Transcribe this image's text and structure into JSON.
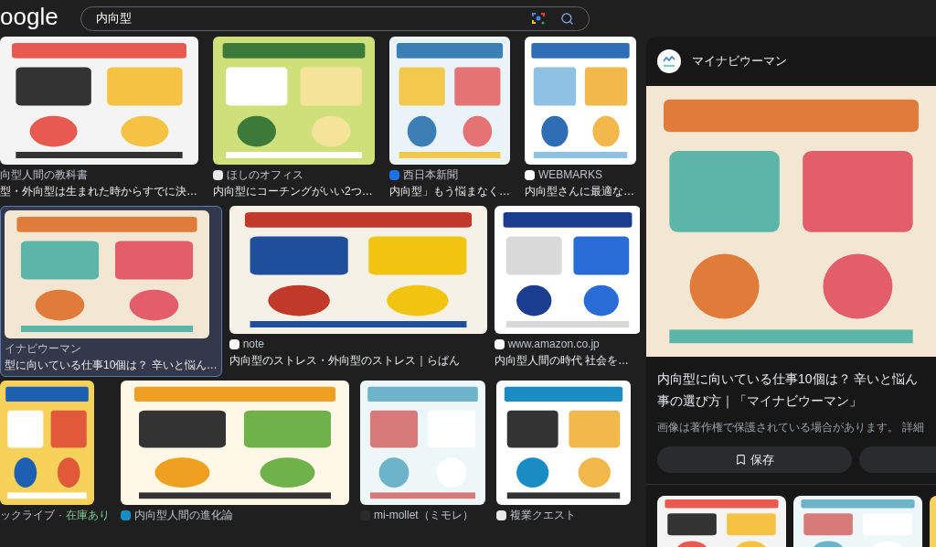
{
  "header": {
    "logo": "oogle",
    "search": {
      "value": "内向型"
    }
  },
  "result_rows": [
    [
      {
        "source": "向型人間の教科書",
        "title": "型・外向型は生まれた時からすでに決…",
        "selected": false,
        "has_icon": false
      },
      {
        "source": "ほしのオフィス",
        "title": "内向型にコーチングがいい2つ…",
        "selected": false,
        "has_icon": true
      },
      {
        "source": "西日本新聞",
        "title": "内向型」もう悩まなく…",
        "selected": false,
        "has_icon": true
      },
      {
        "source": "WEBMARKS",
        "title": "内向型さんに最適な…",
        "selected": false,
        "has_icon": true
      }
    ],
    [
      {
        "source": "イナビウーマン",
        "title": "型に向いている仕事10個は？ 辛いと悩ん…",
        "selected": true,
        "has_icon": false
      },
      {
        "source": "note",
        "title": "内向型のストレス・外向型のストレス｜らぱん",
        "selected": false,
        "has_icon": true
      },
      {
        "source": "www.amazon.co.jp",
        "title": "内向型人間の時代 社会を…",
        "selected": false,
        "has_icon": true
      }
    ],
    [
      {
        "source": "ックライブ",
        "separator": "·",
        "stock": "在庫あり",
        "selected": false,
        "has_icon": false
      },
      {
        "source": "内向型人間の進化論",
        "selected": false,
        "has_icon": true
      },
      {
        "source": "mi-mollet（ミモレ）",
        "selected": false,
        "has_icon": true
      },
      {
        "source": "複業クエスト",
        "selected": false,
        "has_icon": true
      }
    ]
  ],
  "panel": {
    "source": "マイナビウーマン",
    "title_lines": [
      "内向型に向いている仕事10個は？ 辛いと悩ん",
      "事の選び方｜「マイナビウーマン」"
    ],
    "notice": "画像は著作権で保護されている場合があります。",
    "notice_link": "詳細",
    "save_button": "保存"
  }
}
